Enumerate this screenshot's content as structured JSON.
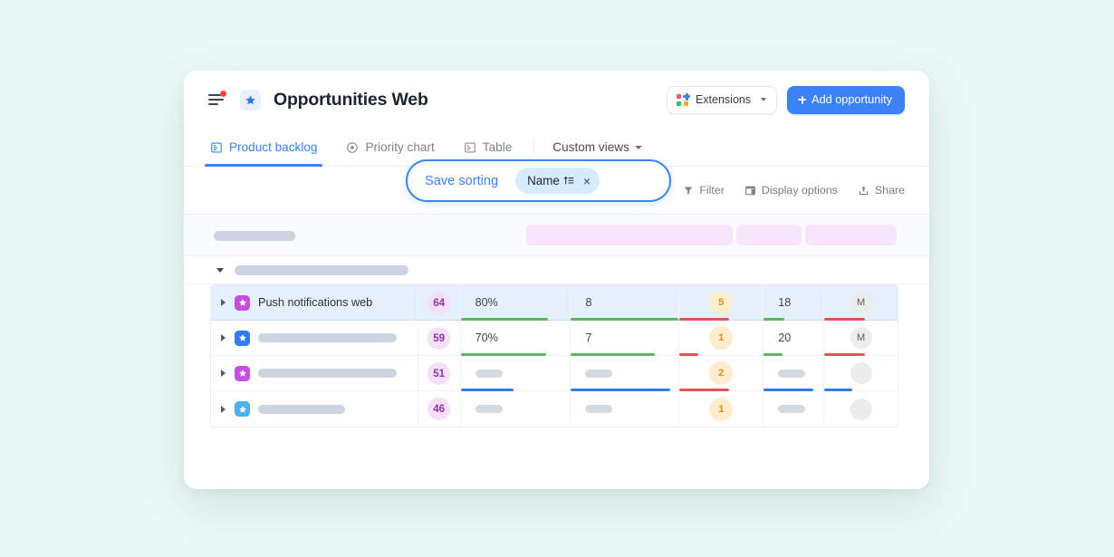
{
  "app": {
    "title": "Opportunities Web",
    "menu_icon": "hamburger-menu-icon",
    "notification_dot": "notification-dot",
    "favorite_icon": "star-icon"
  },
  "header": {
    "extensions_label": "Extensions",
    "extensions_icon": "extensions-grid-icon",
    "extensions_caret": "chevron-down-icon",
    "add_label": "Add opportunity",
    "add_icon": "plus-icon"
  },
  "tabs": [
    {
      "label": "Product backlog",
      "icon": "board-icon",
      "active": true
    },
    {
      "label": "Priority chart",
      "icon": "target-icon",
      "active": false
    },
    {
      "label": "Table",
      "icon": "table-icon",
      "active": false
    }
  ],
  "custom_views": {
    "label": "Custom views",
    "icon": "chevron-down-icon"
  },
  "toolbar": {
    "save_sorting_label": "Save sorting",
    "sort_chip_label": "Name",
    "sort_chip_icon": "sort-ascending-icon",
    "sort_chip_close": "×",
    "filter_label": "Filter",
    "filter_icon": "funnel-icon",
    "display_options_label": "Display options",
    "display_options_icon": "layout-icon",
    "share_label": "Share",
    "share_icon": "share-icon"
  },
  "skeleton": {
    "left_pill": "",
    "blocks": [
      "",
      "",
      ""
    ]
  },
  "group_row": {
    "chevron": "chevron-down-icon",
    "placeholder": ""
  },
  "table": {
    "columns": [
      "name",
      "score",
      "percent",
      "count",
      "badge",
      "number",
      "owner"
    ],
    "rows": [
      {
        "name": "Push notifications web",
        "name_masked": false,
        "icon_color": "#c64ee0",
        "score": "64",
        "percent": "80%",
        "percent_masked": false,
        "count": "8",
        "count_masked": false,
        "badge": "5",
        "number": "18",
        "number_masked": false,
        "owner": "M",
        "owner_masked": false,
        "selected": true,
        "bars": {
          "percent": "#5cb860",
          "count": "#5cb860",
          "badge": "#e8524f",
          "number": "#5cb860",
          "owner": "#e8524f"
        },
        "bar_widths": {
          "percent": "80%",
          "count": "100%",
          "badge": "60%",
          "number": "35%",
          "owner": "55%"
        }
      },
      {
        "name": "",
        "name_masked": true,
        "icon_color": "#2f7cf6",
        "score": "59",
        "percent": "70%",
        "percent_masked": false,
        "count": "7",
        "count_masked": false,
        "badge": "1",
        "number": "20",
        "number_masked": false,
        "owner": "M",
        "owner_masked": false,
        "selected": false,
        "bars": {
          "percent": "#5cb860",
          "count": "#5cb860",
          "badge": "#e8524f",
          "number": "#5cb860",
          "owner": "#e8524f"
        },
        "bar_widths": {
          "percent": "78%",
          "count": "78%",
          "badge": "22%",
          "number": "32%",
          "owner": "55%"
        }
      },
      {
        "name": "",
        "name_masked": true,
        "icon_color": "#c64ee0",
        "score": "51",
        "percent": "",
        "percent_masked": true,
        "count": "",
        "count_masked": true,
        "badge": "2",
        "number": "",
        "number_masked": true,
        "owner": "",
        "owner_masked": true,
        "selected": false,
        "bars": {
          "percent": "#2f7cf6",
          "count": "#2f7cf6",
          "badge": "#e8524f",
          "number": "#2f7cf6",
          "owner": "#2f7cf6"
        },
        "bar_widths": {
          "percent": "48%",
          "count": "92%",
          "badge": "60%",
          "number": "83%",
          "owner": "38%"
        }
      },
      {
        "name": "",
        "name_masked": true,
        "icon_color": "#45b4f0",
        "score": "46",
        "percent": "",
        "percent_masked": true,
        "count": "",
        "count_masked": true,
        "badge": "1",
        "number": "",
        "number_masked": true,
        "owner": "",
        "owner_masked": true,
        "selected": false,
        "bars": {
          "percent": "",
          "count": "",
          "badge": "",
          "number": "",
          "owner": ""
        },
        "bar_widths": {
          "percent": "0%",
          "count": "0%",
          "badge": "0%",
          "number": "0%",
          "owner": "0%"
        }
      }
    ]
  },
  "colors": {
    "accent": "#3b82f6",
    "page_background": "#eaf8f5",
    "selected_row": "#e6f0fd",
    "score_chip": "#f6dffa",
    "badge_chip": "#fdeccd",
    "skeleton_block": "#f7e6fb"
  }
}
